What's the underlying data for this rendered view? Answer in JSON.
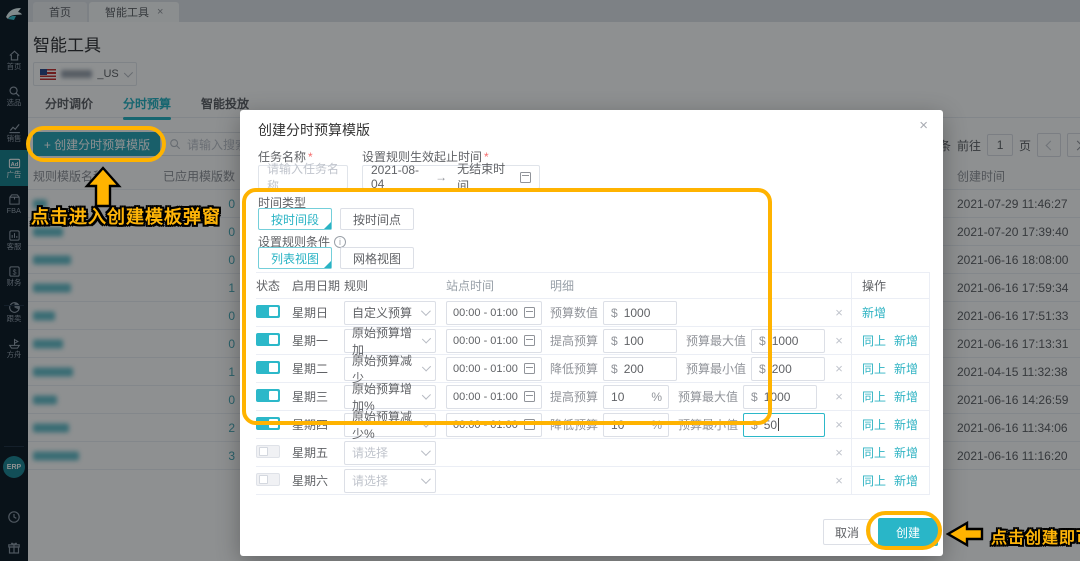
{
  "colors": {
    "brand": "#29b6c8",
    "annotation": "#ffb300",
    "sidebar_active": "#19818f"
  },
  "icons": {
    "close": "×",
    "delete": "×",
    "info": "i",
    "range_arrow": "→"
  },
  "sidebar": {
    "items": [
      {
        "label": "首页",
        "icon": "home",
        "active": false
      },
      {
        "label": "选品",
        "icon": "search",
        "active": false
      },
      {
        "label": "销售",
        "icon": "chart",
        "active": false
      },
      {
        "label": "广告",
        "icon": "ad",
        "active": true
      },
      {
        "label": "FBA",
        "icon": "fba",
        "active": false
      },
      {
        "label": "客服",
        "icon": "service",
        "active": false
      },
      {
        "label": "财务",
        "icon": "finance",
        "active": false
      },
      {
        "label": "跟卖",
        "icon": "pie",
        "active": false
      },
      {
        "label": "方舟",
        "icon": "ark",
        "active": false
      }
    ],
    "erp_label": "ERP"
  },
  "tabbar": {
    "tabs": [
      {
        "label": "首页",
        "active": false,
        "closable": false
      },
      {
        "label": "智能工具",
        "active": true,
        "closable": true
      }
    ]
  },
  "page": {
    "title": "智能工具",
    "account": {
      "suffix": "_US"
    },
    "tabs": [
      {
        "label": "分时调价",
        "active": false
      },
      {
        "label": "分时预算",
        "active": true
      },
      {
        "label": "智能投放",
        "active": false
      }
    ],
    "create_button": "+ 创建分时预算模版",
    "search_placeholder": "请输入搜索内容",
    "pagination": {
      "unit": "条",
      "goto": "前往",
      "page": "1",
      "page_word": "页"
    },
    "table": {
      "name_header": "规则模版名称",
      "applied_header": "已应用模版数",
      "created_header": "创建时间",
      "rows": [
        {
          "redact_w": 14,
          "applied": "0",
          "created": "2021-07-29 11:46:27"
        },
        {
          "redact_w": 30,
          "applied": "0",
          "created": "2021-07-20 17:39:40"
        },
        {
          "redact_w": 38,
          "applied": "0",
          "created": "2021-06-16 18:08:00"
        },
        {
          "redact_w": 38,
          "applied": "1",
          "created": "2021-06-16 17:59:34"
        },
        {
          "redact_w": 22,
          "applied": "0",
          "created": "2021-06-16 17:51:33"
        },
        {
          "redact_w": 30,
          "applied": "0",
          "created": "2021-06-16 17:13:31"
        },
        {
          "redact_w": 40,
          "applied": "1",
          "created": "2021-04-15 11:32:38"
        },
        {
          "redact_w": 24,
          "applied": "0",
          "created": "2021-06-16 14:26:59"
        },
        {
          "redact_w": 36,
          "applied": "2",
          "created": "2021-06-16 11:34:06"
        },
        {
          "redact_w": 46,
          "applied": "3",
          "created": "2021-06-16 11:16:20"
        }
      ]
    }
  },
  "modal": {
    "title": "创建分时预算模版",
    "required_mark": "*",
    "task_name_label": "任务名称",
    "task_name_placeholder": "请输入任务名称",
    "time_range_label": "设置规则生效起止时间",
    "start_date": "2021-08-04",
    "end_date": "无结束时间",
    "time_type_label": "时间类型",
    "time_type_options": [
      {
        "label": "按时间段",
        "selected": true
      },
      {
        "label": "按时间点",
        "selected": false
      }
    ],
    "rule_cond_label": "设置规则条件",
    "view_options": [
      {
        "label": "列表视图",
        "selected": true
      },
      {
        "label": "网格视图",
        "selected": false
      }
    ],
    "table": {
      "headers": {
        "status": "状态",
        "day": "启用日期",
        "rule": "规则",
        "time": "站点时间",
        "detail": "明细",
        "op": "操作"
      },
      "rows": [
        {
          "enabled": true,
          "day": "星期日",
          "rule": "自定义预算",
          "time": "00:00 - 01:00",
          "details": [
            {
              "label": "预算数值",
              "prefix": "$",
              "value": "1000"
            }
          ],
          "actions": [
            "新增"
          ]
        },
        {
          "enabled": true,
          "day": "星期一",
          "rule": "原始预算增加",
          "time": "00:00 - 01:00",
          "details": [
            {
              "label": "提高预算",
              "prefix": "$",
              "value": "100"
            },
            {
              "label": "预算最大值",
              "prefix": "$",
              "value": "1000"
            }
          ],
          "actions": [
            "同上",
            "新增"
          ]
        },
        {
          "enabled": true,
          "day": "星期二",
          "rule": "原始预算减少",
          "time": "00:00 - 01:00",
          "details": [
            {
              "label": "降低预算",
              "prefix": "$",
              "value": "200"
            },
            {
              "label": "预算最小值",
              "prefix": "$",
              "value": "200"
            }
          ],
          "actions": [
            "同上",
            "新增"
          ]
        },
        {
          "enabled": true,
          "day": "星期三",
          "rule": "原始预算增加%",
          "time": "00:00 - 01:00",
          "details": [
            {
              "label": "提高预算",
              "value": "10",
              "suffix": "%"
            },
            {
              "label": "预算最大值",
              "prefix": "$",
              "value": "1000"
            }
          ],
          "actions": [
            "同上",
            "新增"
          ]
        },
        {
          "enabled": true,
          "day": "星期四",
          "rule": "原始预算减少%",
          "time": "00:00 - 01:00",
          "details": [
            {
              "label": "降低预算",
              "value": "10",
              "suffix": "%"
            },
            {
              "label": "预算最小值",
              "prefix": "$",
              "value": "50",
              "focused": true
            }
          ],
          "actions": [
            "同上",
            "新增"
          ]
        },
        {
          "enabled": false,
          "day": "星期五",
          "rule_placeholder": "请选择",
          "details": [],
          "actions": [
            "同上",
            "新增"
          ]
        },
        {
          "enabled": false,
          "day": "星期六",
          "rule_placeholder": "请选择",
          "details": [],
          "actions": [
            "同上",
            "新增"
          ]
        }
      ]
    },
    "cancel_label": "取消",
    "create_label": "创建"
  },
  "annotations": {
    "create_template": "点击进入创建模板弹窗",
    "create_confirm": "点击创建即可"
  }
}
